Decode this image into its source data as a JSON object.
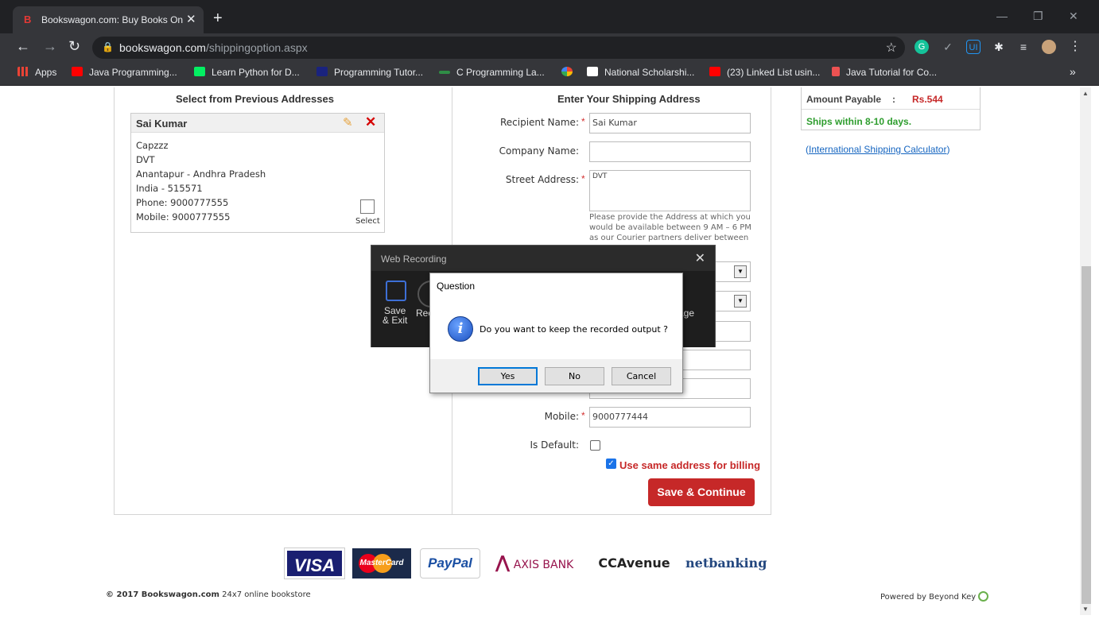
{
  "browser": {
    "tab_title": "Bookswagon.com: Buy Books On",
    "tab_favicon": "B",
    "url_domain": "bookswagon.com",
    "url_path": "/shippingoption.aspx",
    "bookmarks": [
      {
        "label": "Apps",
        "icon": "apps-grid-icon",
        "color": "#ea4335"
      },
      {
        "label": "Java Programming...",
        "icon": "youtube-icon",
        "color": "#ff0000"
      },
      {
        "label": "Learn Python for D...",
        "icon": "datacamp-icon",
        "color": "#03ef62"
      },
      {
        "label": "Programming Tutor...",
        "icon": "tutorial-icon",
        "color": "#1a237e"
      },
      {
        "label": "C Programming La...",
        "icon": "geeks-icon",
        "color": "#2f8d46"
      },
      {
        "label": "",
        "icon": "pinwheel-icon",
        "color": "#fbbc05"
      },
      {
        "label": "National Scholarshi...",
        "icon": "scholarship-icon",
        "color": "#ffffff"
      },
      {
        "label": "(23) Linked List usin...",
        "icon": "youtube-icon",
        "color": "#ff0000"
      },
      {
        "label": "Java Tutorial for Co...",
        "icon": "udemy-icon",
        "color": "#ec5252"
      }
    ],
    "more_bookmarks": "»"
  },
  "prev_addresses": {
    "title": "Select from Previous Addresses",
    "card": {
      "name": "Sai Kumar",
      "lines": [
        "Capzzz",
        "DVT",
        "Anantapur - Andhra Pradesh",
        "India - 515571",
        "Phone: 9000777555",
        "Mobile: 9000777555"
      ],
      "select_label": "Select"
    }
  },
  "shipping_form": {
    "title": "Enter Your Shipping Address",
    "recipient_label": "Recipient Name:",
    "recipient_value": "Sai Kumar",
    "company_label": "Company Name:",
    "company_value": "",
    "street_label": "Street Address:",
    "street_value": "DVT",
    "street_hint_1": "Please provide the Address at which you",
    "street_hint_2": "would be available between 9 AM – 6 PM",
    "street_hint_3": "as our Courier partners deliver between",
    "mobile_label": "Mobile:",
    "mobile_value": "9000777444",
    "default_label": "Is Default:",
    "billing_label": "Use same address for billing",
    "save_button": "Save & Continue"
  },
  "summary": {
    "amount_label": "Amount Payable",
    "amount_sep": ":",
    "amount_value": "Rs.544",
    "ships_text": "Ships within 8-10 days.",
    "calc_open": "(",
    "calc_link": "International Shipping Calculator",
    "calc_close": ")"
  },
  "footer": {
    "logos": [
      "VISA",
      "MasterCard",
      "PayPal",
      "AXIS BANK",
      "CCAvenue",
      "netbanking"
    ],
    "copyright": "© 2017 Bookswagon.com",
    "tagline": "24x7 online bookstore",
    "powered": "Powered by Beyond Key"
  },
  "recording_window": {
    "title": "Web Recording",
    "save_exit_1": "Save",
    "save_exit_2": "& Exit",
    "rec_partial": "Rec",
    "age_partial": "age"
  },
  "question_dialog": {
    "title": "Question",
    "message": "Do you want to keep the recorded output ?",
    "yes": "Yes",
    "no": "No",
    "cancel": "Cancel"
  }
}
